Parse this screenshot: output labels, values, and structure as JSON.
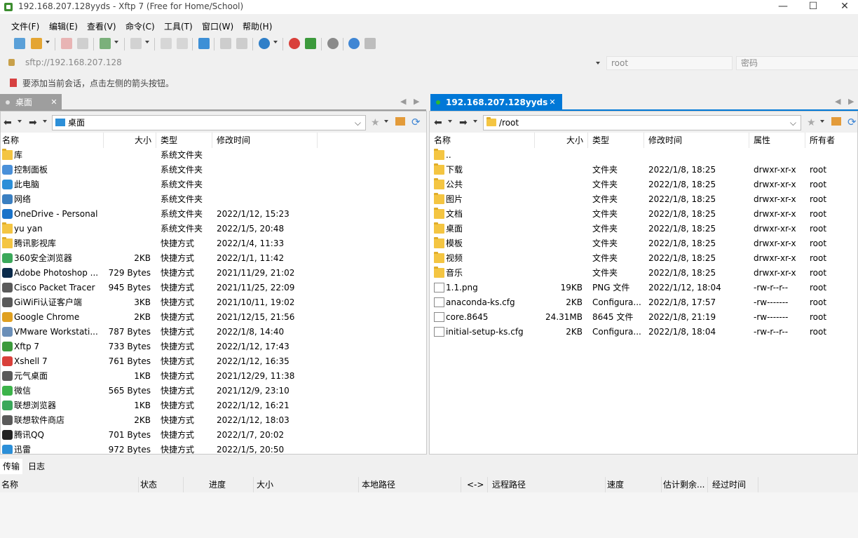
{
  "window": {
    "title": "192.168.207.128yyds - Xftp 7 (Free for Home/School)",
    "minimize_glyph": "—",
    "maximize_glyph": "☐",
    "close_glyph": "✕"
  },
  "menu": [
    "文件(F)",
    "编辑(E)",
    "查看(V)",
    "命令(C)",
    "工具(T)",
    "窗口(W)",
    "帮助(H)"
  ],
  "toolbar": {
    "icons": [
      "new-session-icon",
      "open-session-icon",
      "disconnect-icon",
      "reconnect-icon",
      "new-window-icon",
      "view-icon",
      "copy-icon",
      "paste-icon",
      "transfer-icon",
      "properties-icon",
      "delete-icon",
      "globe-icon",
      "xshell-icon",
      "xftp-icon",
      "settings-icon",
      "help-icon",
      "chat-icon"
    ]
  },
  "address": {
    "host": "sftp://192.168.207.128",
    "user_placeholder": "root",
    "password_placeholder": "密码"
  },
  "hint": "要添加当前会话，点击左侧的箭头按钮。",
  "local": {
    "tab_label": "桌面",
    "path": "桌面",
    "columns": [
      "名称",
      "大小",
      "类型",
      "修改时间"
    ],
    "files": [
      {
        "name": "库",
        "size": "",
        "type": "系统文件夹",
        "modified": "",
        "icon": "folder-icon"
      },
      {
        "name": "控制面板",
        "size": "",
        "type": "系统文件夹",
        "modified": "",
        "icon": "control-panel-icon"
      },
      {
        "name": "此电脑",
        "size": "",
        "type": "系统文件夹",
        "modified": "",
        "icon": "computer-icon"
      },
      {
        "name": "网络",
        "size": "",
        "type": "系统文件夹",
        "modified": "",
        "icon": "network-icon"
      },
      {
        "name": "OneDrive - Personal",
        "size": "",
        "type": "系统文件夹",
        "modified": "2022/1/12, 15:23",
        "icon": "onedrive-icon"
      },
      {
        "name": "yu yan",
        "size": "",
        "type": "系统文件夹",
        "modified": "2022/1/5, 20:48",
        "icon": "folder-icon"
      },
      {
        "name": "腾讯影视库",
        "size": "",
        "type": "快捷方式",
        "modified": "2022/1/4, 11:33",
        "icon": "folder-icon"
      },
      {
        "name": "360安全浏览器",
        "size": "2KB",
        "type": "快捷方式",
        "modified": "2022/1/1, 11:42",
        "icon": "browser-icon"
      },
      {
        "name": "Adobe Photoshop ...",
        "size": "729 Bytes",
        "type": "快捷方式",
        "modified": "2021/11/29, 21:02",
        "icon": "photoshop-icon"
      },
      {
        "name": "Cisco Packet Tracer",
        "size": "945 Bytes",
        "type": "快捷方式",
        "modified": "2021/11/25, 22:09",
        "icon": "app-icon"
      },
      {
        "name": "GiWiFi认证客户端",
        "size": "3KB",
        "type": "快捷方式",
        "modified": "2021/10/11, 19:02",
        "icon": "app-icon"
      },
      {
        "name": "Google Chrome",
        "size": "2KB",
        "type": "快捷方式",
        "modified": "2021/12/15, 21:56",
        "icon": "chrome-icon"
      },
      {
        "name": "VMware Workstati...",
        "size": "787 Bytes",
        "type": "快捷方式",
        "modified": "2022/1/8, 14:40",
        "icon": "vmware-icon"
      },
      {
        "name": "Xftp 7",
        "size": "733 Bytes",
        "type": "快捷方式",
        "modified": "2022/1/12, 17:43",
        "icon": "xftp-icon"
      },
      {
        "name": "Xshell 7",
        "size": "761 Bytes",
        "type": "快捷方式",
        "modified": "2022/1/12, 16:35",
        "icon": "xshell-icon"
      },
      {
        "name": "元气桌面",
        "size": "1KB",
        "type": "快捷方式",
        "modified": "2021/12/29, 11:38",
        "icon": "app-icon"
      },
      {
        "name": "微信",
        "size": "565 Bytes",
        "type": "快捷方式",
        "modified": "2021/12/9, 23:10",
        "icon": "wechat-icon"
      },
      {
        "name": "联想浏览器",
        "size": "1KB",
        "type": "快捷方式",
        "modified": "2022/1/12, 16:21",
        "icon": "browser-icon"
      },
      {
        "name": "联想软件商店",
        "size": "2KB",
        "type": "快捷方式",
        "modified": "2022/1/12, 18:03",
        "icon": "app-icon"
      },
      {
        "name": "腾讯QQ",
        "size": "701 Bytes",
        "type": "快捷方式",
        "modified": "2022/1/7, 20:02",
        "icon": "qq-icon"
      },
      {
        "name": "迅雷",
        "size": "972 Bytes",
        "type": "快捷方式",
        "modified": "2022/1/5, 20:50",
        "icon": "xunlei-icon"
      }
    ]
  },
  "remote": {
    "tab_label": "192.168.207.128yyds",
    "path": "/root",
    "columns": [
      "名称",
      "大小",
      "类型",
      "修改时间",
      "属性",
      "所有者"
    ],
    "files": [
      {
        "name": "..",
        "size": "",
        "type": "",
        "modified": "",
        "attr": "",
        "owner": "",
        "icon": "folder-icon"
      },
      {
        "name": "下载",
        "size": "",
        "type": "文件夹",
        "modified": "2022/1/8, 18:25",
        "attr": "drwxr-xr-x",
        "owner": "root",
        "icon": "folder-icon"
      },
      {
        "name": "公共",
        "size": "",
        "type": "文件夹",
        "modified": "2022/1/8, 18:25",
        "attr": "drwxr-xr-x",
        "owner": "root",
        "icon": "folder-icon"
      },
      {
        "name": "图片",
        "size": "",
        "type": "文件夹",
        "modified": "2022/1/8, 18:25",
        "attr": "drwxr-xr-x",
        "owner": "root",
        "icon": "folder-icon"
      },
      {
        "name": "文档",
        "size": "",
        "type": "文件夹",
        "modified": "2022/1/8, 18:25",
        "attr": "drwxr-xr-x",
        "owner": "root",
        "icon": "folder-icon"
      },
      {
        "name": "桌面",
        "size": "",
        "type": "文件夹",
        "modified": "2022/1/8, 18:25",
        "attr": "drwxr-xr-x",
        "owner": "root",
        "icon": "folder-icon"
      },
      {
        "name": "模板",
        "size": "",
        "type": "文件夹",
        "modified": "2022/1/8, 18:25",
        "attr": "drwxr-xr-x",
        "owner": "root",
        "icon": "folder-icon"
      },
      {
        "name": "视频",
        "size": "",
        "type": "文件夹",
        "modified": "2022/1/8, 18:25",
        "attr": "drwxr-xr-x",
        "owner": "root",
        "icon": "folder-icon"
      },
      {
        "name": "音乐",
        "size": "",
        "type": "文件夹",
        "modified": "2022/1/8, 18:25",
        "attr": "drwxr-xr-x",
        "owner": "root",
        "icon": "folder-icon"
      },
      {
        "name": "1.1.png",
        "size": "19KB",
        "type": "PNG 文件",
        "modified": "2022/1/12, 18:04",
        "attr": "-rw-r--r--",
        "owner": "root",
        "icon": "image-file-icon"
      },
      {
        "name": "anaconda-ks.cfg",
        "size": "2KB",
        "type": "Configura...",
        "modified": "2022/1/8, 17:57",
        "attr": "-rw-------",
        "owner": "root",
        "icon": "config-file-icon"
      },
      {
        "name": "core.8645",
        "size": "24.31MB",
        "type": "8645 文件",
        "modified": "2022/1/8, 21:19",
        "attr": "-rw-------",
        "owner": "root",
        "icon": "file-icon"
      },
      {
        "name": "initial-setup-ks.cfg",
        "size": "2KB",
        "type": "Configura...",
        "modified": "2022/1/8, 18:04",
        "attr": "-rw-r--r--",
        "owner": "root",
        "icon": "config-file-icon"
      }
    ]
  },
  "transfer": {
    "tabs": [
      "传输",
      "日志"
    ],
    "columns": [
      "名称",
      "状态",
      "进度",
      "大小",
      "本地路径",
      "<->",
      "远程路径",
      "速度",
      "估计剩余...",
      "经过时间"
    ]
  },
  "colors": {
    "accent": "#0078d7",
    "active_tab": "#0078d7",
    "connected_dot": "#2eb82e",
    "folder": "#f4c542"
  }
}
